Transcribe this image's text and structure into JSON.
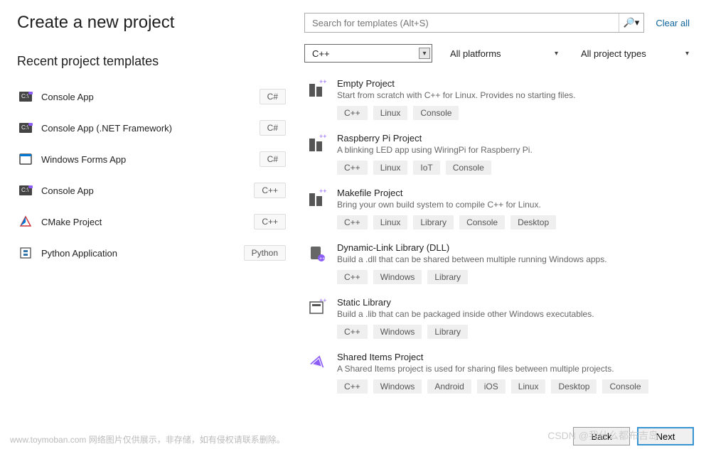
{
  "header": {
    "title": "Create a new project"
  },
  "recent": {
    "title": "Recent project templates",
    "items": [
      {
        "label": "Console App",
        "lang": "C#"
      },
      {
        "label": "Console App (.NET Framework)",
        "lang": "C#"
      },
      {
        "label": "Windows Forms App",
        "lang": "C#"
      },
      {
        "label": "Console App",
        "lang": "C++"
      },
      {
        "label": "CMake Project",
        "lang": "C++"
      },
      {
        "label": "Python Application",
        "lang": "Python"
      }
    ]
  },
  "search": {
    "placeholder": "Search for templates (Alt+S)"
  },
  "clear_all": "Clear all",
  "filters": {
    "language": "C++",
    "platform": "All platforms",
    "project_type": "All project types"
  },
  "templates": [
    {
      "title": "Empty Project",
      "desc": "Start from scratch with C++ for Linux. Provides no starting files.",
      "tags": [
        "C++",
        "Linux",
        "Console"
      ]
    },
    {
      "title": "Raspberry Pi Project",
      "desc": "A blinking LED app using WiringPi for Raspberry Pi.",
      "tags": [
        "C++",
        "Linux",
        "IoT",
        "Console"
      ]
    },
    {
      "title": "Makefile Project",
      "desc": "Bring your own build system to compile C++ for Linux.",
      "tags": [
        "C++",
        "Linux",
        "Library",
        "Console",
        "Desktop"
      ]
    },
    {
      "title": "Dynamic-Link Library (DLL)",
      "desc": "Build a .dll that can be shared between multiple running Windows apps.",
      "tags": [
        "C++",
        "Windows",
        "Library"
      ]
    },
    {
      "title": "Static Library",
      "desc": "Build a .lib that can be packaged inside other Windows executables.",
      "tags": [
        "C++",
        "Windows",
        "Library"
      ]
    },
    {
      "title": "Shared Items Project",
      "desc": "A Shared Items project is used for sharing files between multiple projects.",
      "tags": [
        "C++",
        "Windows",
        "Android",
        "iOS",
        "Linux",
        "Desktop",
        "Console"
      ]
    }
  ],
  "buttons": {
    "back": "Back",
    "next": "Next"
  },
  "watermark_left": "www.toymoban.com  网络图片仅供展示，非存储，如有侵权请联系删除。",
  "watermark_right": "CSDN @我什么都布吉岛"
}
